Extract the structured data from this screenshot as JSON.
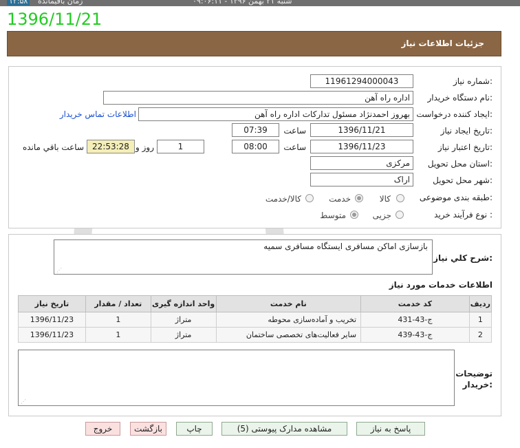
{
  "topbar": {
    "date_label": "شنبه ۲۱ بهمن ۱۳۹۶ - ۰۹:۰۶:۱۱",
    "clock": "۱۲:۵۸",
    "clock_label": "زمان باقیمانده"
  },
  "big_date": "1396/11/21",
  "header": {
    "title": "جزئیات اطلاعات نیاز"
  },
  "form": {
    "need_number_label": "شماره نیاز:",
    "need_number": "11961294000043",
    "buyer_org_label": "نام دستگاه خریدار:",
    "buyer_org": "اداره راه آهن",
    "creator_label": "ایجاد کننده درخواست:",
    "creator": "بهروز احمدنژاد مسئول تدارکات اداره راه آهن",
    "contact_link": "اطلاعات تماس خریدار",
    "created_date_label": "تاریخ ایجاد نیاز:",
    "created_date": "1396/11/21",
    "time_label": "ساعت",
    "created_time": "07:39",
    "valid_date_label": "تاریخ اعتبار نیاز:",
    "valid_date": "1396/11/23",
    "valid_time": "08:00",
    "days": "1",
    "day_and_label": "روز و",
    "remaining_time": "22:53:28",
    "remaining_label": "ساعت باقي مانده",
    "province_label": "استان محل تحویل:",
    "province": "مرکزی",
    "city_label": "شهر محل تحویل:",
    "city": "اراک",
    "category_label": "طبقه بندی موضوعی:",
    "category_options": [
      "کالا",
      "خدمت",
      "کالا/خدمت"
    ],
    "category_selected": "خدمت",
    "process_label": "نوع فرآیند خرید :",
    "process_options": [
      "جزیی",
      "متوسط"
    ],
    "process_selected": "متوسط"
  },
  "summary": {
    "label": "شرح کلي نياز:",
    "text": "بازسازی اماکن مسافری ایستگاه مسافری سمیه"
  },
  "services": {
    "title": "اطلاعات خدمات مورد نیاز",
    "columns": [
      "ردیف",
      "کد خدمت",
      "نام خدمت",
      "واحد اندازه گیری",
      "تعداد / مقدار",
      "تاریخ نیاز"
    ],
    "rows": [
      {
        "row": "1",
        "code": "ج-43-431",
        "name": "تخریب و آماده‌سازی محوطه",
        "unit": "متراژ",
        "qty": "1",
        "date": "1396/11/23"
      },
      {
        "row": "2",
        "code": "ج-43-439",
        "name": "سایر فعالیت‌های تخصصی ساختمان",
        "unit": "متراژ",
        "qty": "1",
        "date": "1396/11/23"
      }
    ]
  },
  "buyer_notes": {
    "label_line1": "توضیحات",
    "label_line2": "خریدار:",
    "text": ""
  },
  "buttons": {
    "reply": "پاسخ به نیاز",
    "attachments": "مشاهده مدارک پیوستی (5)",
    "print": "چاپ",
    "back": "بازگشت",
    "exit": "خروج"
  },
  "colors": {
    "header_bg": "#8a6644",
    "big_date": "#22cc22",
    "link": "#1a4fd0",
    "remaining_bg": "#f4eeb8",
    "button_bg": "#eaf4ea",
    "exit_button_bg": "#fbe0e0"
  }
}
